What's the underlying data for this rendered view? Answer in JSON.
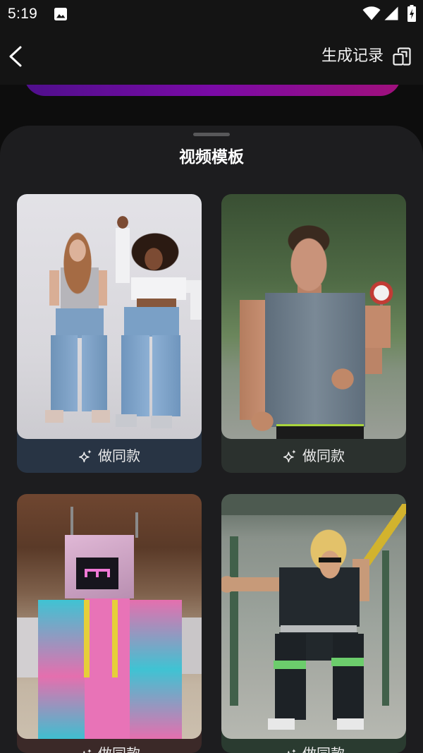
{
  "status_bar": {
    "time": "5:19",
    "icons": [
      "image-icon",
      "wifi-icon",
      "signal-icon",
      "battery-charging-icon"
    ]
  },
  "header": {
    "back_icon": "back-arrow-icon",
    "history_label": "生成记录",
    "history_icon": "history-icon"
  },
  "colors": {
    "app_bg": "#0d0d0d",
    "header_bg": "#141414",
    "sheet_bg": "#1d1d1f",
    "accent_gradient": [
      "#4f0f8c",
      "#7a0aa6",
      "#a0107c"
    ]
  },
  "sheet": {
    "title": "视频模板",
    "templates": [
      {
        "action_label": "做同款",
        "action_icon": "sparkle-icon",
        "label_bg": "#283444"
      },
      {
        "action_label": "做同款",
        "action_icon": "sparkle-icon",
        "label_bg": "#2b312e"
      },
      {
        "action_label": "做同款",
        "action_icon": "sparkle-icon",
        "label_bg": "#3b2928"
      },
      {
        "action_label": "做同款",
        "action_icon": "sparkle-icon",
        "label_bg": "#2a3b30"
      }
    ]
  }
}
